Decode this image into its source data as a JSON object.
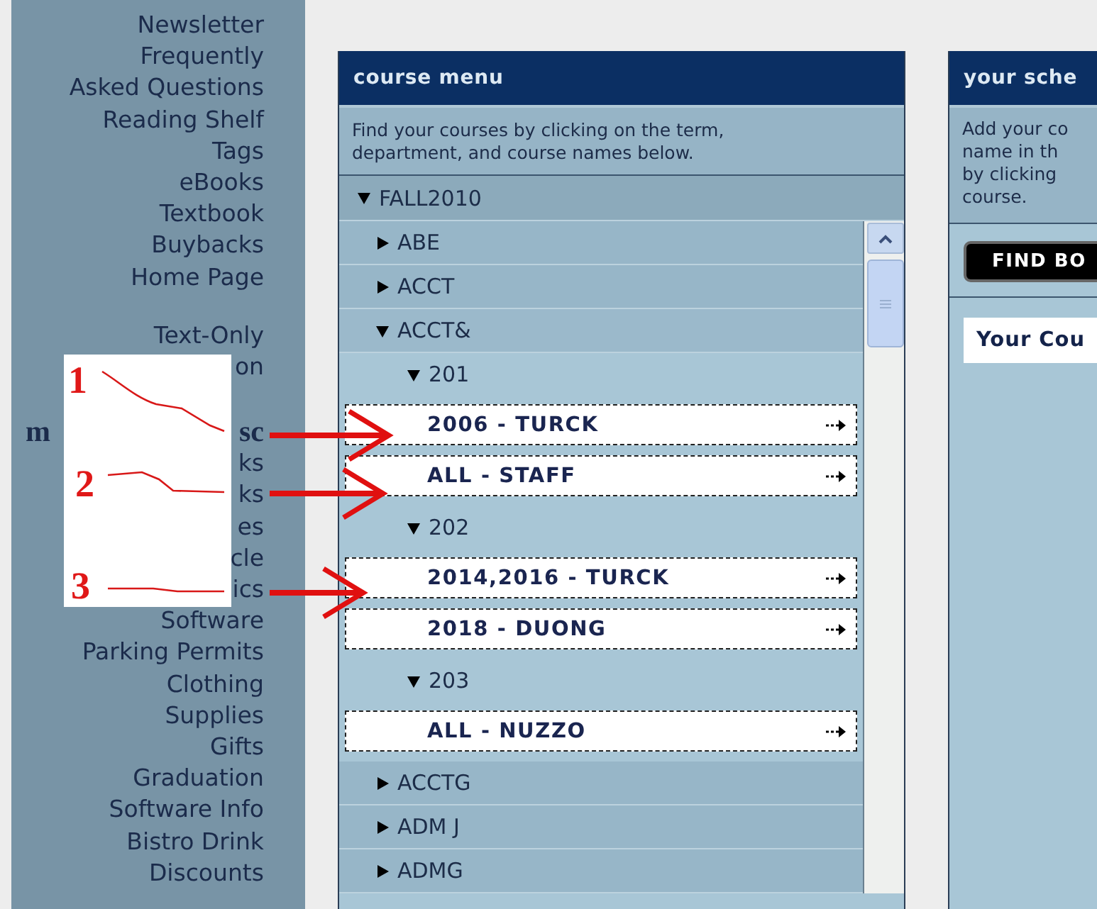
{
  "sidebar": {
    "sections": [
      {
        "items": [
          {
            "kind": "link",
            "text": "Newsletter"
          },
          {
            "kind": "link",
            "text": "Frequently"
          },
          {
            "kind": "link",
            "text": "Asked Questions"
          },
          {
            "kind": "link",
            "text": "Reading Shelf"
          },
          {
            "kind": "link",
            "text": "Tags"
          },
          {
            "kind": "link",
            "text": "eBooks"
          },
          {
            "kind": "link",
            "text": "Textbook"
          },
          {
            "kind": "link",
            "text": "Buybacks"
          },
          {
            "kind": "link",
            "text": "Home Page"
          }
        ]
      },
      {
        "items": [
          {
            "kind": "link",
            "text": "Text-Only"
          },
          {
            "kind": "link",
            "text": "on"
          }
        ]
      },
      {
        "items": [
          {
            "kind": "heading",
            "text": "m",
            "tail": "sc"
          },
          {
            "kind": "link",
            "text": "ks"
          },
          {
            "kind": "link",
            "text": "ks"
          },
          {
            "kind": "link",
            "text": "es"
          },
          {
            "kind": "link",
            "text": "cle"
          },
          {
            "kind": "link",
            "text": "ics"
          },
          {
            "kind": "link",
            "text": "Software"
          },
          {
            "kind": "link",
            "text": "Parking Permits"
          },
          {
            "kind": "link",
            "text": "Clothing"
          },
          {
            "kind": "link",
            "text": "Supplies"
          },
          {
            "kind": "link",
            "text": "Gifts"
          },
          {
            "kind": "link",
            "text": "Graduation"
          },
          {
            "kind": "link",
            "text": "Software Info"
          },
          {
            "kind": "link",
            "text": "Bistro Drink"
          },
          {
            "kind": "link",
            "text": "Discounts"
          }
        ]
      }
    ]
  },
  "course_menu": {
    "title": "course menu",
    "description": "Find your courses by clicking on the term, department, and course names below.",
    "tree": [
      {
        "kind": "group",
        "label": "FALL2010",
        "expanded": true,
        "children": [
          {
            "kind": "group",
            "label": "ABE",
            "expanded": false
          },
          {
            "kind": "group",
            "label": "ACCT",
            "expanded": false
          },
          {
            "kind": "group",
            "label": "ACCT&",
            "expanded": true,
            "children": [
              {
                "kind": "group",
                "label": "201",
                "expanded": true,
                "children": [
                  {
                    "kind": "course",
                    "label": "2006 - TURCK"
                  },
                  {
                    "kind": "course",
                    "label": "ALL - STAFF"
                  }
                ]
              },
              {
                "kind": "group",
                "label": "202",
                "expanded": true,
                "children": [
                  {
                    "kind": "course",
                    "label": "2014,2016 - TURCK"
                  },
                  {
                    "kind": "course",
                    "label": "2018 - DUONG"
                  }
                ]
              },
              {
                "kind": "group",
                "label": "203",
                "expanded": true,
                "children": [
                  {
                    "kind": "course",
                    "label": "ALL - NUZZO"
                  }
                ]
              }
            ]
          },
          {
            "kind": "group",
            "label": "ACCTG",
            "expanded": false
          },
          {
            "kind": "group",
            "label": "ADM J",
            "expanded": false
          },
          {
            "kind": "group",
            "label": "ADMG",
            "expanded": false
          }
        ]
      }
    ]
  },
  "schedule": {
    "title": "your sche",
    "description_lines": [
      "Add your co",
      "name in th",
      "by clicking",
      "course."
    ],
    "button": "FIND BO",
    "courses_heading": "Your Cou"
  },
  "annotations": [
    {
      "number": "1"
    },
    {
      "number": "2"
    },
    {
      "number": "3"
    }
  ]
}
